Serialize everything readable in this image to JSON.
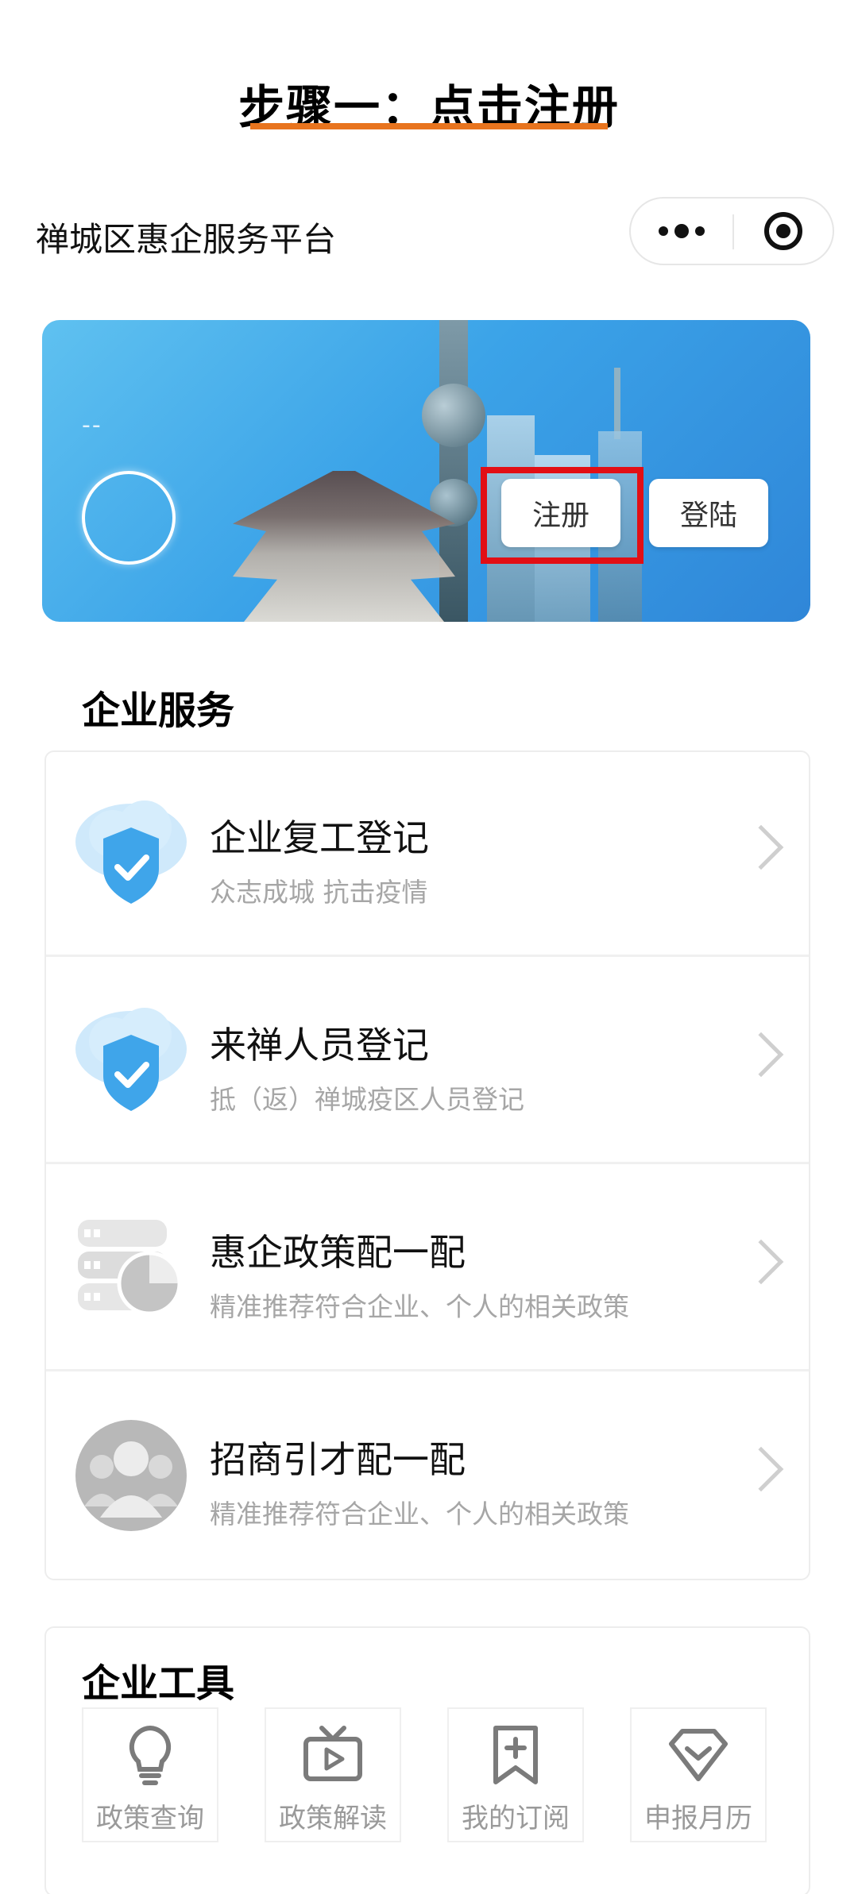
{
  "step_title": "步骤一：点击注册",
  "nav": {
    "title": "禅城区惠企服务平台",
    "more_icon": "more-dots-icon",
    "close_icon": "target-circle-icon"
  },
  "banner": {
    "user_placeholder": "--",
    "register_label": "注册",
    "login_label": "登陆"
  },
  "services": {
    "title": "企业服务",
    "items": [
      {
        "title": "企业复工登记",
        "subtitle": "众志成城 抗击疫情",
        "icon": "cloud-shield-check-icon"
      },
      {
        "title": "来禅人员登记",
        "subtitle": "抵（返）禅城疫区人员登记",
        "icon": "cloud-shield-check-icon"
      },
      {
        "title": "惠企政策配一配",
        "subtitle": "精准推荐符合企业、个人的相关政策",
        "icon": "server-chart-icon"
      },
      {
        "title": "招商引才配一配",
        "subtitle": "精准推荐符合企业、个人的相关政策",
        "icon": "people-group-icon"
      }
    ]
  },
  "tools": {
    "title": "企业工具",
    "items": [
      {
        "label": "政策查询",
        "icon": "lightbulb-icon"
      },
      {
        "label": "政策解读",
        "icon": "tv-play-icon"
      },
      {
        "label": "我的订阅",
        "icon": "bookmark-plus-icon"
      },
      {
        "label": "申报月历",
        "icon": "diamond-badge-icon"
      }
    ]
  },
  "colors": {
    "accent_underline": "#e8741e",
    "highlight_box": "#e20f15",
    "banner_blue": "#3ba3e8",
    "shield_blue": "#3fa5ea"
  }
}
